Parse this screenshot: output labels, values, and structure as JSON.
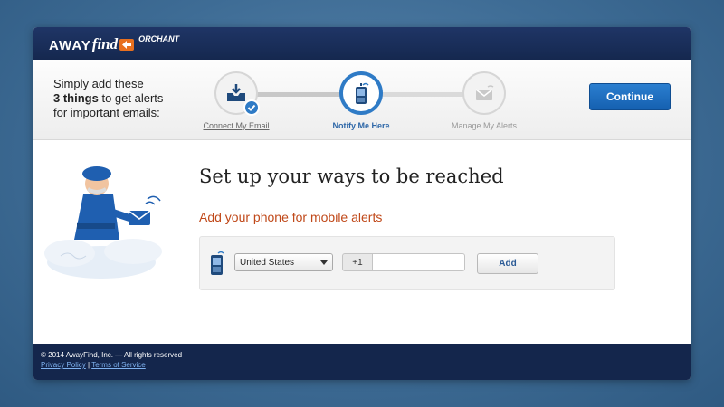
{
  "brand": {
    "logo_away": "AWAY",
    "logo_find": "find",
    "logo_suffix": "ORCHANT"
  },
  "steps_panel": {
    "intro_line1": "Simply add these",
    "intro_bold": "3 things",
    "intro_line2_rest": " to get alerts",
    "intro_line3": "for important emails:",
    "steps": [
      {
        "label": "Connect My Email",
        "state": "done",
        "icon": "inbox-icon"
      },
      {
        "label": "Notify Me Here",
        "state": "active",
        "icon": "mobile-phone-icon"
      },
      {
        "label": "Manage My Alerts",
        "state": "pending",
        "icon": "envelope-icon"
      }
    ],
    "continue_label": "Continue"
  },
  "main": {
    "headline": "Set up your ways to be reached",
    "subhead": "Add your phone for mobile alerts",
    "country_select": "United States",
    "country_code": "+1",
    "phone_value": "",
    "add_label": "Add"
  },
  "footer": {
    "copyright": "© 2014 AwayFind, Inc. — All rights reserved",
    "privacy_link": "Privacy Policy",
    "separator": "|",
    "terms_link": "Terms of Service"
  },
  "colors": {
    "accent_blue": "#2f7bc6",
    "header_navy": "#1f3566",
    "subhead_orange": "#c0491a",
    "logo_orange": "#e8701f"
  }
}
